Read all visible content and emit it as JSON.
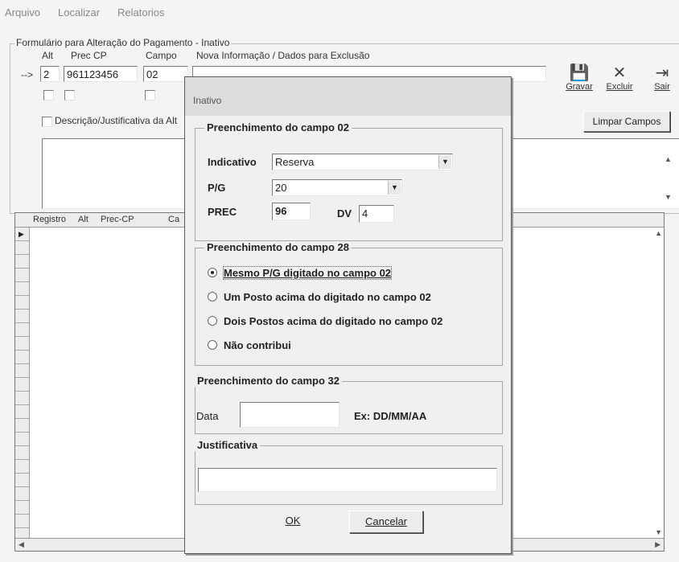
{
  "menu": {
    "items": [
      "Arquivo",
      "Localizar",
      "Relatorios"
    ]
  },
  "form": {
    "group_title": "Formulário para Alteração do Pagamento - Inativo",
    "col_alt": "Alt",
    "col_prec_cp": "Prec CP",
    "col_campo": "Campo",
    "col_nova_info": "Nova Informação / Dados para Exclusão",
    "row_arrow": "-->",
    "alt_value": "2",
    "prec_cp_value": "961123456",
    "campo_value": "02",
    "desc_checkbox_label": "Descrição/Justificativa da Alt"
  },
  "toolbar": {
    "gravar_label": "Gravar",
    "excluir_label": "Excluir",
    "sair_label": "Sair",
    "limpar_label": "Limpar Campos"
  },
  "grid": {
    "columns": [
      "Registro",
      "Alt",
      "Prec-CP",
      "Ca"
    ]
  },
  "dialog": {
    "title": "Inativo",
    "group02_title": "Preenchimento do campo 02",
    "indicativo_label": "Indicativo",
    "indicativo_value": "Reserva",
    "pg_label": "P/G",
    "pg_value": "20",
    "prec_label": "PREC",
    "prec_value": "96",
    "dv_label": "DV",
    "dv_value": "4",
    "group28_title": "Preenchimento do campo 28",
    "radio1": "Mesmo P/G digitado no campo 02",
    "radio2": "Um Posto acima do digitado no campo 02",
    "radio3": "Dois Postos acima do digitado no campo 02",
    "radio4": "Não contribui",
    "selected_radio": "radio1",
    "group32_title": "Preenchimento do campo 32",
    "data_label": "Data",
    "data_value": "",
    "data_hint": "Ex: DD/MM/AA",
    "just_title": "Justificativa",
    "just_value": "",
    "ok_label": "OK",
    "cancel_label": "Cancelar"
  }
}
